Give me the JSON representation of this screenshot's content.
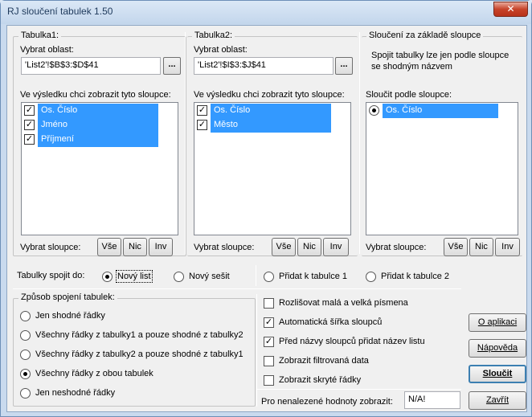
{
  "window": {
    "title": "RJ sloučení tabulek 1.50",
    "close_label": "✕"
  },
  "table1": {
    "group_title": "Tabulka1:",
    "range_label": "Vybrat oblast:",
    "range_value": "'List2'!$B$3:$D$41",
    "browse_label": "...",
    "columns_label": "Ve výsledku chci zobrazit tyto sloupce:",
    "columns": [
      "Os. Číslo",
      "Jméno",
      "Příjmení"
    ],
    "select_label": "Vybrat sloupce:",
    "btn_all": "Vše",
    "btn_none": "Nic",
    "btn_inv": "Inv"
  },
  "table2": {
    "group_title": "Tabulka2:",
    "range_label": "Vybrat oblast:",
    "range_value": "'List2'!$I$3:$J$41",
    "browse_label": "...",
    "columns_label": "Ve výsledku chci zobrazit tyto sloupce:",
    "columns": [
      "Os. Číslo",
      "Město"
    ],
    "select_label": "Vybrat sloupce:",
    "btn_all": "Vše",
    "btn_none": "Nic",
    "btn_inv": "Inv"
  },
  "merge": {
    "group_title": "Sloučení za základě sloupce",
    "info_line1": "Spojit tabulky lze jen podle sloupce",
    "info_line2": "se shodným názvem",
    "by_label": "Sloučit podle sloupce:",
    "columns": [
      "Os. Číslo"
    ],
    "select_label": "Vybrat sloupce:",
    "btn_all": "Vše",
    "btn_none": "Nic",
    "btn_inv": "Inv"
  },
  "target": {
    "label": "Tabulky spojit do:",
    "opt_new_sheet": "Nový list",
    "opt_new_workbook": "Nový sešit",
    "opt_add_t1": "Přidat k tabulce 1",
    "opt_add_t2": "Přidat k tabulce 2",
    "selected": "new_sheet"
  },
  "join": {
    "group_title": "Způsob spojení tabulek:",
    "options": [
      "Jen shodné řádky",
      "Všechny řádky z tabulky1 a pouze shodné z tabulky2",
      "Všechny řádky z tabulky2 a pouze shodné z tabulky1",
      "Všechny řádky z obou tabulek",
      "Jen neshodné řádky"
    ],
    "selected_index": 3
  },
  "settings": {
    "case_sensitive": "Rozlišovat malá a velká písmena",
    "auto_width": "Automatická šířka sloupců",
    "prefix_sheet": "Před názvy sloupců přidat název listu",
    "show_filtered": "Zobrazit filtrovaná data",
    "show_hidden": "Zobrazit skryté řádky",
    "checked": [
      false,
      true,
      true,
      false,
      false
    ],
    "missing_label": "Pro nenalezené hodnoty zobrazit:",
    "missing_value": "N/A!"
  },
  "buttons": {
    "about": "O aplikaci",
    "help": "Nápověda",
    "merge": "Sloučit",
    "close": "Zavřít"
  }
}
